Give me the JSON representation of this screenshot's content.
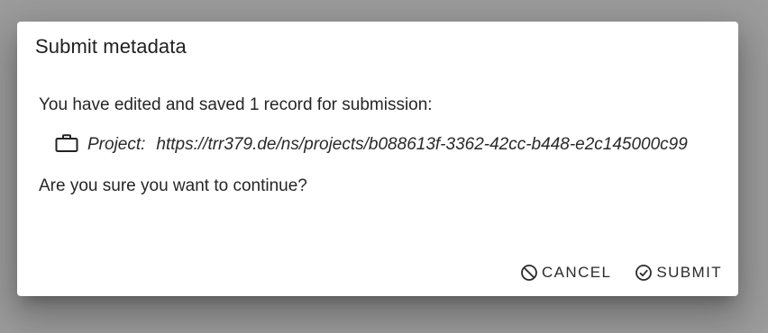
{
  "dialog": {
    "title": "Submit metadata",
    "intro": "You have edited and saved 1 record for submission:",
    "record": {
      "icon": "briefcase-icon",
      "label": "Project:",
      "url": "https://trr379.de/ns/projects/b088613f-3362-42cc-b448-e2c145000c99"
    },
    "question": "Are you sure you want to continue?",
    "actions": {
      "cancel_label": "CANCEL",
      "cancel_icon": "cancel-circle-icon",
      "submit_label": "SUBMIT",
      "submit_icon": "check-circle-icon"
    }
  },
  "colors": {
    "backdrop": "#9c9c9c",
    "dialog_background": "#ffffff",
    "text": "#212121"
  }
}
